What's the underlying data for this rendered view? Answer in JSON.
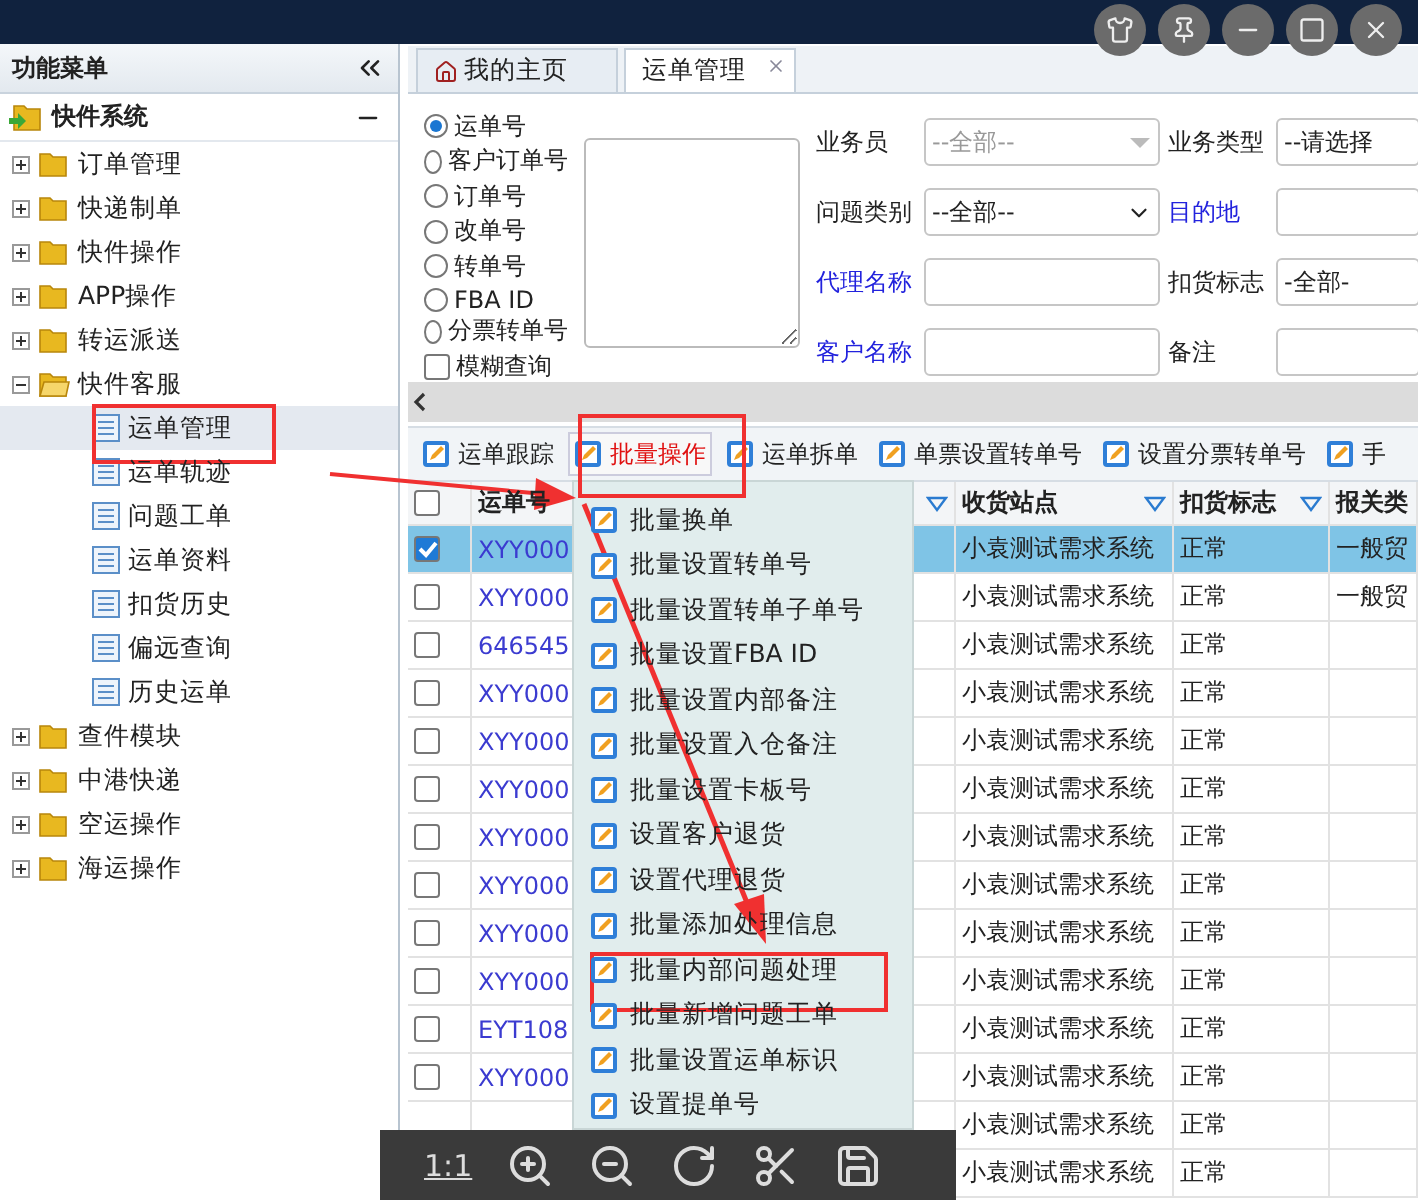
{
  "sidebar": {
    "title": "功能菜单",
    "root": {
      "label": "快件系统",
      "expanded": true,
      "children": [
        {
          "label": "订单管理",
          "expanded": false
        },
        {
          "label": "快递制单",
          "expanded": false
        },
        {
          "label": "快件操作",
          "expanded": false
        },
        {
          "label": "APP操作",
          "expanded": false
        },
        {
          "label": "转运派送",
          "expanded": false
        },
        {
          "label": "快件客服",
          "expanded": true,
          "children": [
            {
              "label": "运单管理",
              "selected": true
            },
            {
              "label": "运单轨迹",
              "selected": false
            },
            {
              "label": "问题工单",
              "selected": false
            },
            {
              "label": "运单资料",
              "selected": false
            },
            {
              "label": "扣货历史",
              "selected": false
            },
            {
              "label": "偏远查询",
              "selected": false
            },
            {
              "label": "历史运单",
              "selected": false
            }
          ]
        },
        {
          "label": "查件模块",
          "expanded": false
        },
        {
          "label": "中港快递",
          "expanded": false
        },
        {
          "label": "空运操作",
          "expanded": false
        },
        {
          "label": "海运操作",
          "expanded": false
        }
      ]
    }
  },
  "tabs": [
    {
      "label": "我的主页",
      "kind": "home",
      "selected": false
    },
    {
      "label": "运单管理",
      "kind": "closable",
      "selected": true
    }
  ],
  "search_form": {
    "radios": [
      {
        "label": "运单号",
        "selected": true
      },
      {
        "label": "客户订单号",
        "selected": false
      },
      {
        "label": "订单号",
        "selected": false
      },
      {
        "label": "改单号",
        "selected": false
      },
      {
        "label": "转单号",
        "selected": false
      },
      {
        "label": "FBA ID",
        "selected": false
      },
      {
        "label": "分票转单号",
        "selected": false
      }
    ],
    "fuzzy": {
      "label": "模糊查询",
      "checked": false
    },
    "filters": [
      {
        "label": "业务员",
        "link": false,
        "kind": "combo",
        "placeholder": "--全部--"
      },
      {
        "label": "业务类型",
        "link": false,
        "kind": "select",
        "value": "--请选择"
      },
      {
        "label": "问题类别",
        "link": false,
        "kind": "dropdown",
        "value": "--全部--"
      },
      {
        "label": "目的地",
        "link": true,
        "kind": "input"
      },
      {
        "label": "代理名称",
        "link": true,
        "kind": "input"
      },
      {
        "label": "扣货标志",
        "link": false,
        "kind": "select",
        "value": "-全部-"
      },
      {
        "label": "客户名称",
        "link": true,
        "kind": "input"
      },
      {
        "label": "备注",
        "link": false,
        "kind": "input"
      }
    ]
  },
  "toolbar": [
    {
      "label": "运单跟踪",
      "selected": false
    },
    {
      "label": "批量操作",
      "selected": true
    },
    {
      "label": "运单拆单",
      "selected": false
    },
    {
      "label": "单票设置转单号",
      "selected": false
    },
    {
      "label": "设置分票转单号",
      "selected": false
    },
    {
      "label": "手",
      "selected": false
    }
  ],
  "batch_menu": [
    "批量换单",
    "批量设置转单号",
    "批量设置转单子单号",
    "批量设置FBA ID",
    "批量设置内部备注",
    "批量设置入仓备注",
    "批量设置卡板号",
    "设置客户退货",
    "设置代理退货",
    "批量添加处理信息",
    "批量内部问题处理",
    "批量新增问题工单",
    "批量设置运单标识",
    "设置提单号"
  ],
  "table": {
    "all_checked": false,
    "columns": [
      {
        "label": "运单号",
        "filter": false
      },
      {
        "filter": true
      },
      {
        "label": "收货站点",
        "filter": true
      },
      {
        "label": "扣货标志",
        "filter": true
      },
      {
        "label": "报关类",
        "filter": false
      }
    ],
    "rows": [
      {
        "checked": true,
        "waybill": "XYY000",
        "station": "小袁测试需求系统",
        "hold": "正常",
        "customs": "一般贸"
      },
      {
        "checked": false,
        "waybill": "XYY000",
        "station": "小袁测试需求系统",
        "hold": "正常",
        "customs": "一般贸"
      },
      {
        "checked": false,
        "waybill": "646545",
        "station": "小袁测试需求系统",
        "hold": "正常"
      },
      {
        "checked": false,
        "waybill": "XYY000",
        "station": "小袁测试需求系统",
        "hold": "正常"
      },
      {
        "checked": false,
        "waybill": "XYY000",
        "station": "小袁测试需求系统",
        "hold": "正常"
      },
      {
        "checked": false,
        "waybill": "XYY000",
        "station": "小袁测试需求系统",
        "hold": "正常"
      },
      {
        "checked": false,
        "waybill": "XYY000",
        "station": "小袁测试需求系统",
        "hold": "正常"
      },
      {
        "checked": false,
        "waybill": "XYY000",
        "station": "小袁测试需求系统",
        "hold": "正常"
      },
      {
        "checked": false,
        "waybill": "XYY000",
        "station": "小袁测试需求系统",
        "hold": "正常"
      },
      {
        "checked": false,
        "waybill": "XYY000",
        "station": "小袁测试需求系统",
        "hold": "正常"
      },
      {
        "checked": false,
        "waybill": "EYT108",
        "station": "小袁测试需求系统",
        "hold": "正常"
      },
      {
        "checked": false,
        "waybill": "XYY000",
        "station": "小袁测试需求系统",
        "hold": "正常"
      },
      {
        "station": "小袁测试需求系统",
        "hold": "正常"
      },
      {
        "station": "小袁测试需求系统",
        "hold": "正常"
      }
    ]
  },
  "viewer": {
    "zoom_label": "1:1"
  }
}
